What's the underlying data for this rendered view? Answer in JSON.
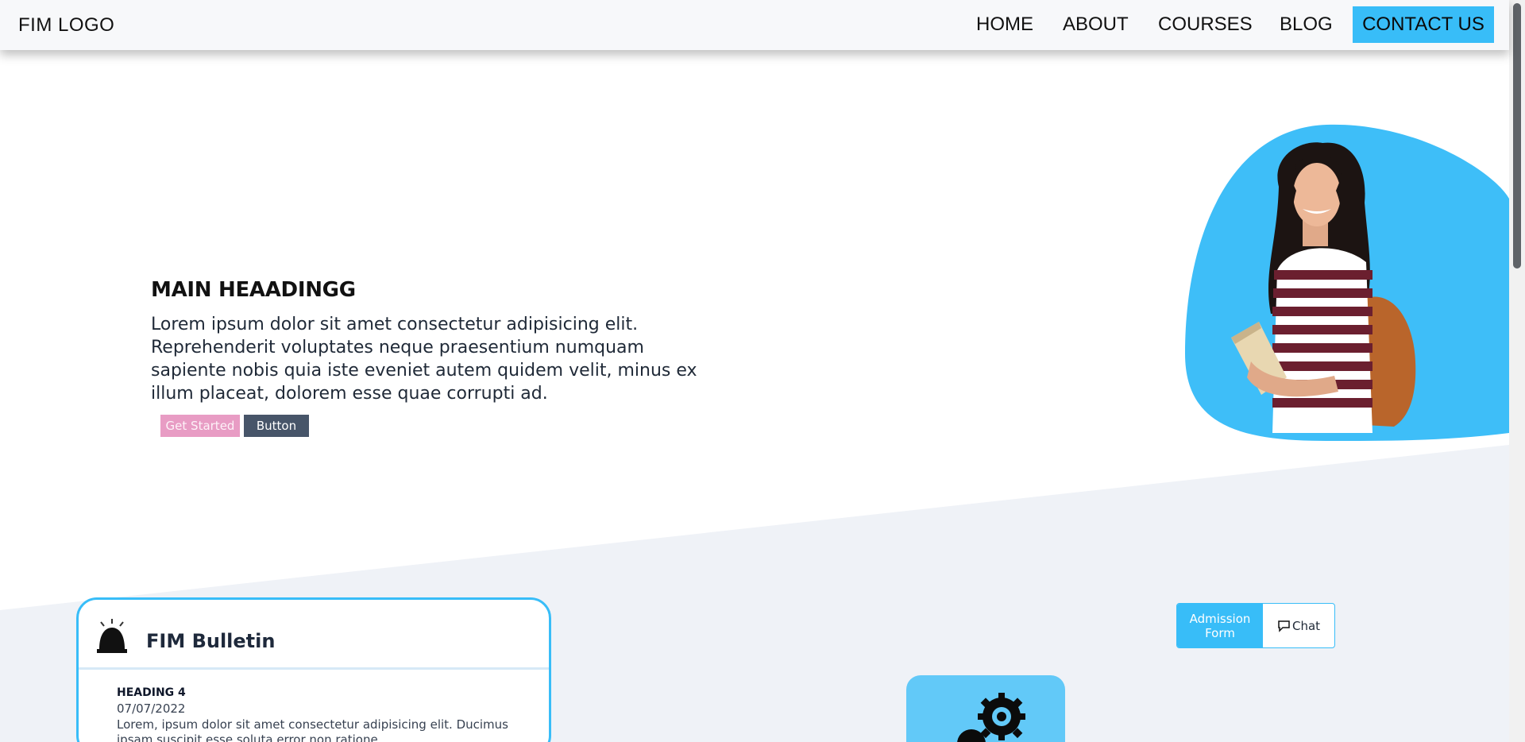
{
  "navbar": {
    "logo": "FIM LOGO",
    "links": [
      "HOME",
      "ABOUT",
      "COURSES",
      "BLOG"
    ],
    "contact": "CONTACT US"
  },
  "hero": {
    "heading": "MAIN HEAADINGG",
    "text": "Lorem ipsum dolor sit amet consectetur adipisicing elit. Reprehenderit voluptates neque praesentium numquam sapiente nobis quia iste eveniet autem quidem velit, minus ex illum placeat, dolorem esse quae corrupti ad.",
    "primary_button": "Get Started",
    "secondary_button": "Button"
  },
  "bulletin": {
    "title": "FIM Bulletin",
    "item": {
      "heading": "HEADING 4",
      "date": "07/07/2022",
      "text": "Lorem, ipsum dolor sit amet consectetur adipisicing elit. Ducimus ipsam suscipit esse soluta error non ratione"
    }
  },
  "quick_actions": {
    "admission": "Admission Form",
    "chat": "Chat"
  },
  "colors": {
    "accent": "#38bdf8",
    "primary_button": "#e89cc4",
    "secondary_button": "#475569",
    "section_bg": "#eff2f7"
  }
}
